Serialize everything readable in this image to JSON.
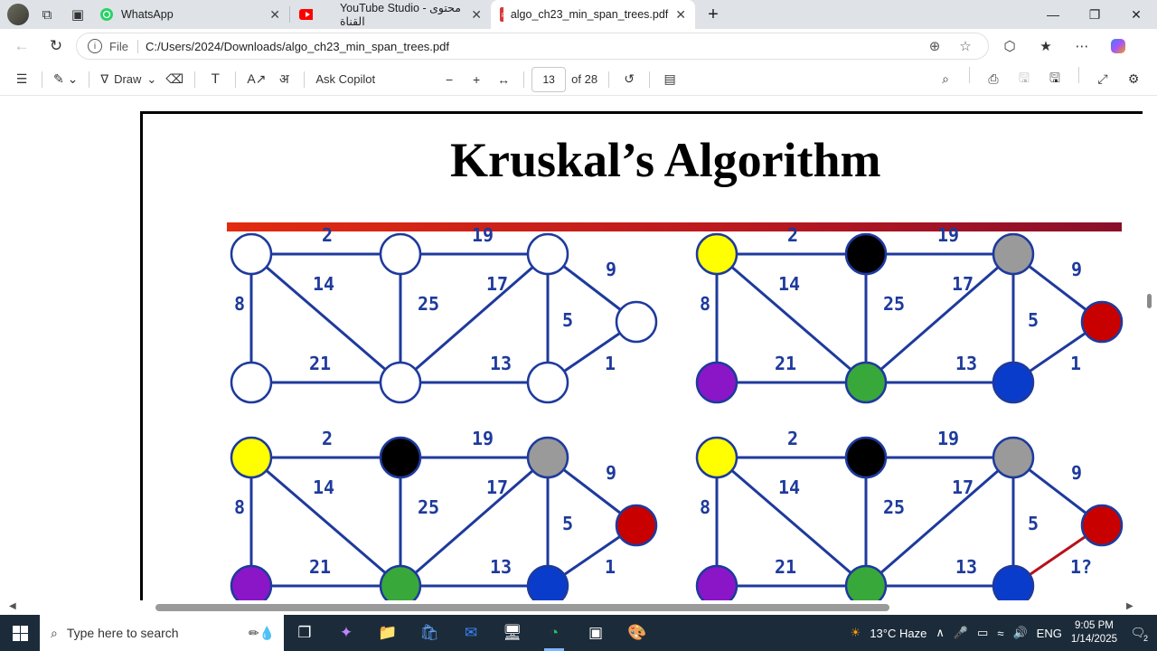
{
  "tabs": [
    {
      "label": "WhatsApp",
      "icon": "whatsapp-icon",
      "color": "#25d366"
    },
    {
      "label": "YouTube Studio - محتوى القناة",
      "icon": "youtube-icon",
      "color": "#ff0000"
    },
    {
      "label": "algo_ch23_min_span_trees.pdf",
      "icon": "pdf-icon",
      "color": "#d63a3a"
    }
  ],
  "address": {
    "scheme": "File",
    "url": "C:/Users/2024/Downloads/algo_ch23_min_span_trees.pdf"
  },
  "pdf_toolbar": {
    "draw_label": "Draw",
    "copilot_label": "Ask Copilot",
    "current_page": "13",
    "total_pages": "of 28"
  },
  "slide": {
    "title": "Kruskal’s Algorithm",
    "weights": [
      "2",
      "19",
      "9",
      "14",
      "17",
      "8",
      "25",
      "5",
      "21",
      "13",
      "1"
    ],
    "last_weight_partial": "1?",
    "vertex_colors": {
      "white": "#ffffff",
      "yellow": "#ffff00",
      "black": "#000000",
      "gray": "#9a9a9a",
      "red": "#c80000",
      "purple": "#8a16c8",
      "green": "#39a83b",
      "blue": "#0a3ccc"
    },
    "edge_color": "#1e3a9c",
    "highlight_edge_color": "#b5121b"
  },
  "taskbar": {
    "search_placeholder": "Type here to search",
    "weather": "13°C  Haze",
    "language": "ENG",
    "time": "9:05 PM",
    "date": "1/14/2025",
    "notifications": "2"
  }
}
